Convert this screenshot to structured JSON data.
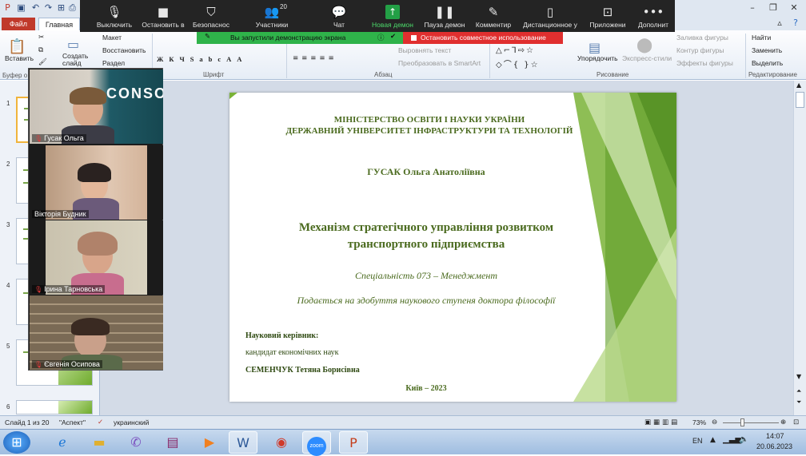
{
  "zoom_toolbar": {
    "mute": "Выключить",
    "stop_video": "Остановить в",
    "security": "Безопаснос",
    "participants": "Участники",
    "participants_count": "20",
    "chat": "Чат",
    "new_demo": "Новая демон",
    "pause_demo": "Пауза демон",
    "comment": "Комментир",
    "remote": "Дистанционное у",
    "apps": "Приложени",
    "more": "Дополнит"
  },
  "share_bar": {
    "text": "Вы запустили демонстрацию экрана",
    "stop": "Остановить совместное использование"
  },
  "ribbon": {
    "tab_file": "Файл",
    "tab_home": "Главная",
    "paste": "Вставить",
    "create_slide": "Создать слайд",
    "layout": "Макет",
    "reset": "Восстановить",
    "section": "Раздел",
    "buffer": "Буфер о",
    "font_group": "Шрифт",
    "paragraph_group": "Абзац",
    "text_align": "Выровнять текст",
    "smartart": "Преобразовать в SmartArt",
    "drawing_group": "Рисование",
    "arrange": "Упорядочить",
    "express_styles": "Экспресс-стили",
    "shape_fill": "Заливка фигуры",
    "shape_outline": "Контур фигуры",
    "shape_effects": "Эффекты фигуры",
    "find": "Найти",
    "replace": "Заменить",
    "select": "Выделить",
    "editing_group": "Редактирование"
  },
  "slide": {
    "ministry": "МІНІСТЕРСТВО ОСВІТИ І НАУКИ УКРАЇНИ",
    "university": "ДЕРЖАВНИЙ УНІВЕРСИТЕТ ІНФРАСТРУКТУРИ ТА ТЕХНОЛОГІЙ",
    "author": "ГУСАК Ольга Анатоліївна",
    "title_line1": "Механізм стратегічного управління розвитком",
    "title_line2": "транспортного підприємства",
    "specialty": "Спеціальність 073 – Менеджмент",
    "degree": "Подається на здобуття наукового ступеня доктора філософії",
    "supervisor_label": "Науковий керівник:",
    "supervisor_degree": "кандидат економічних наук",
    "supervisor_name": "СЕМЕНЧУК Тетяна Борисівна",
    "city_year": "Київ – 2023"
  },
  "thumbnails": [
    "1",
    "2",
    "3",
    "4",
    "5",
    "6"
  ],
  "participants": [
    {
      "name": "Гусак Ольга",
      "muted": true
    },
    {
      "name": "Вікторія Будник",
      "muted": false
    },
    {
      "name": "Ірина Тарновська",
      "muted": true
    },
    {
      "name": "Євгенія Осипова",
      "muted": true
    }
  ],
  "participant_bg_text": "CONSO",
  "status": {
    "slide_info": "Слайд 1 из 20",
    "theme": "\"Аспект\"",
    "language": "украинский",
    "zoom": "73%"
  },
  "taskbar": {
    "lang": "EN",
    "time": "14:07",
    "date": "20.06.2023",
    "zoom_app": "zoom"
  },
  "colors": {
    "zoom_bg": "#242424",
    "share_green": "#2fb34a",
    "stop_red": "#e02f2f",
    "slide_text": "#4a6a1e",
    "slide_accent": "#7ab337",
    "file_tab": "#c0392b"
  }
}
